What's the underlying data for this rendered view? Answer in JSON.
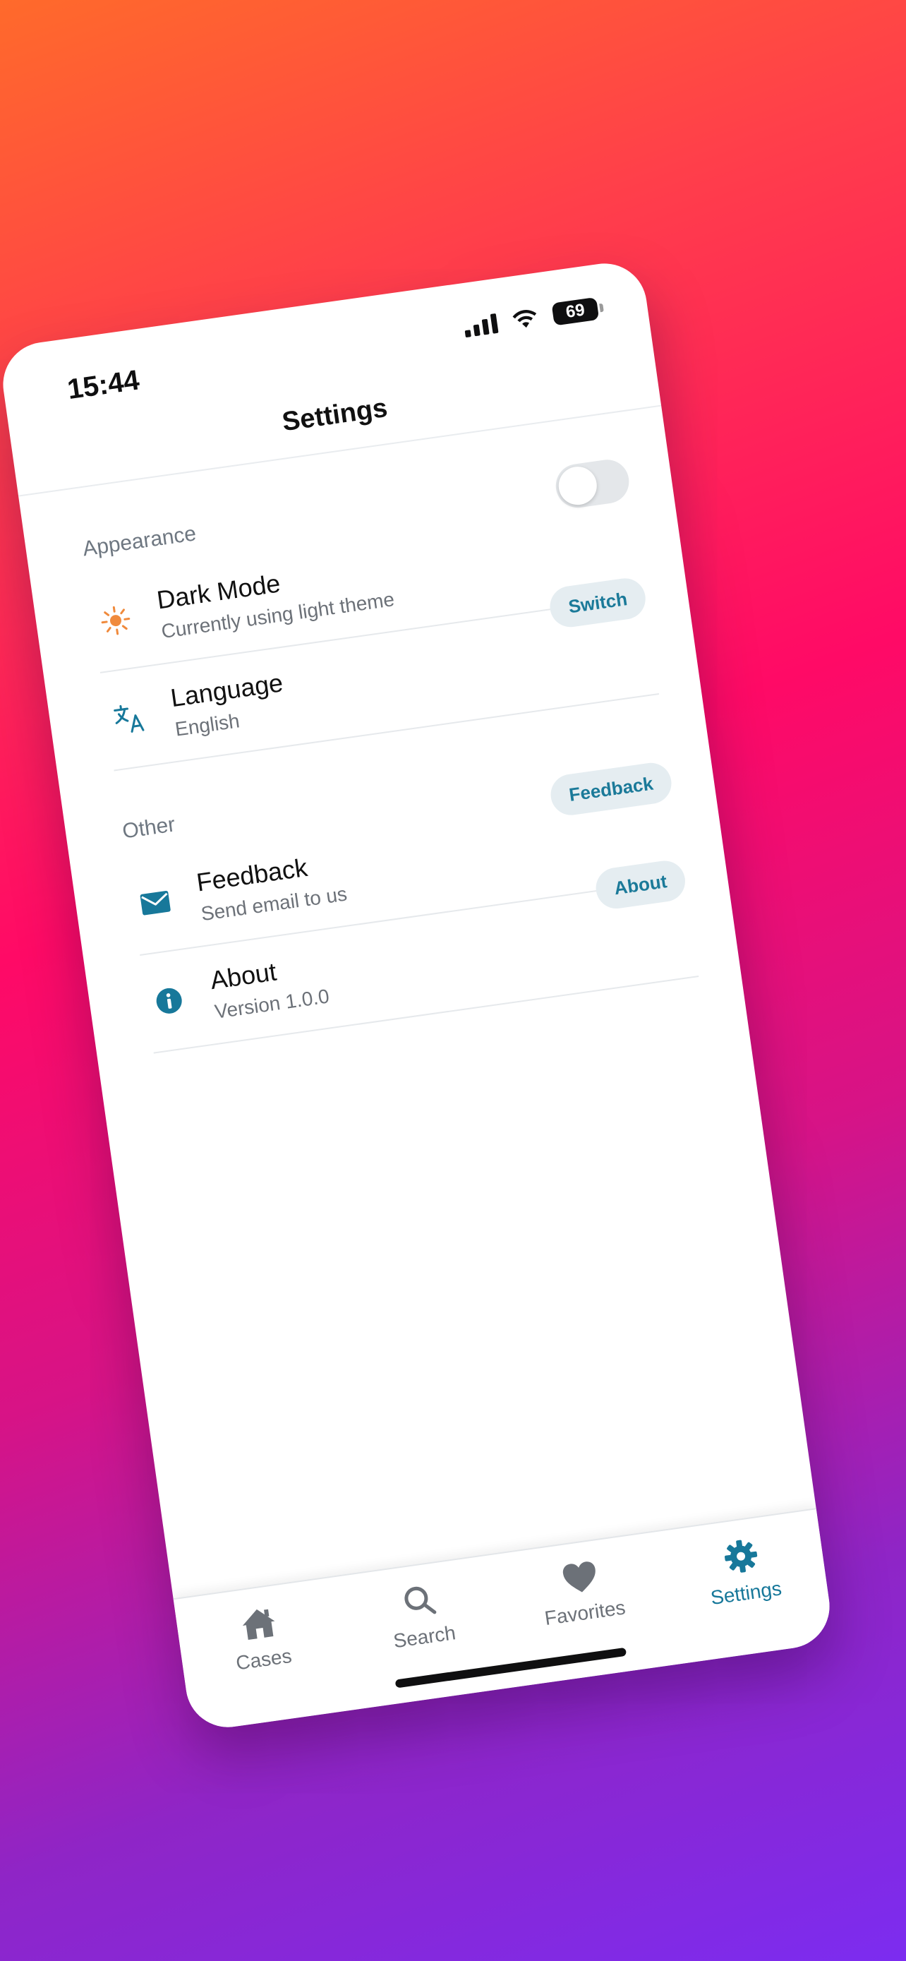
{
  "status_bar": {
    "time": "15:44",
    "battery": "69"
  },
  "header": {
    "title": "Settings"
  },
  "sections": [
    {
      "title": "Appearance",
      "items": [
        {
          "title": "Dark Mode",
          "subtitle": "Currently using light theme",
          "icon": "sun-icon",
          "control": "toggle",
          "toggle_on": false
        },
        {
          "title": "Language",
          "subtitle": "English",
          "icon": "translate-icon",
          "control": "chip",
          "chip_label": "Switch"
        }
      ]
    },
    {
      "title": "Other",
      "items": [
        {
          "title": "Feedback",
          "subtitle": "Send email to us",
          "icon": "mail-icon",
          "control": "chip",
          "chip_label": "Feedback"
        },
        {
          "title": "About",
          "subtitle": "Version 1.0.0",
          "icon": "info-icon",
          "control": "chip",
          "chip_label": "About"
        }
      ]
    }
  ],
  "tabbar": {
    "tabs": [
      {
        "label": "Cases",
        "icon": "home-icon",
        "active": false
      },
      {
        "label": "Search",
        "icon": "search-icon",
        "active": false
      },
      {
        "label": "Favorites",
        "icon": "heart-icon",
        "active": false
      },
      {
        "label": "Settings",
        "icon": "gear-icon",
        "active": true
      }
    ]
  },
  "colors": {
    "accent": "#17789a",
    "sun": "#f08a3c",
    "chip_bg": "#e5edf1",
    "muted_text": "#6c7178"
  }
}
